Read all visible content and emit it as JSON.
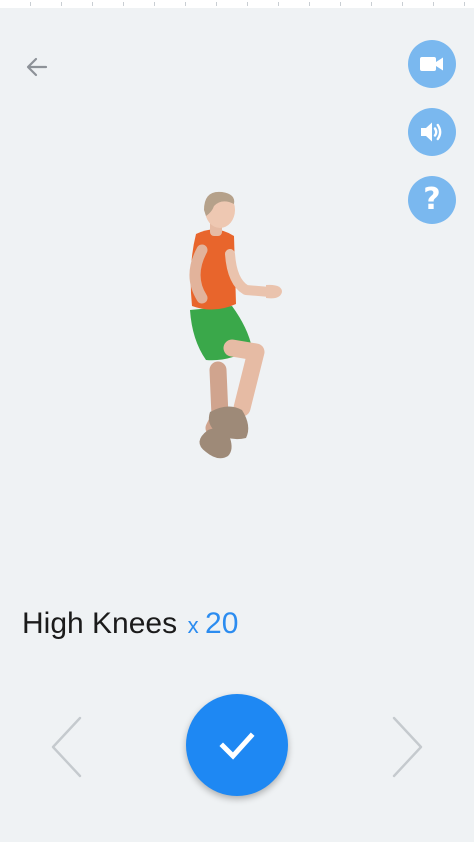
{
  "colors": {
    "background": "#eff2f4",
    "accent": "#1e88f3",
    "action_button_bg": "#7ab8ef",
    "rep_text": "#2b8cf0",
    "nav_arrow": "#c5cace"
  },
  "header": {
    "back_icon": "arrow-left-icon",
    "actions": [
      {
        "name": "video",
        "icon": "video-camera-icon"
      },
      {
        "name": "sound",
        "icon": "speaker-volume-icon"
      },
      {
        "name": "help",
        "icon": "question-mark-icon",
        "glyph": "?"
      }
    ]
  },
  "exercise": {
    "name": "High Knees",
    "multiplier": "x",
    "reps": "20",
    "illustration": "high-knees-exercise-figure"
  },
  "controls": {
    "prev_icon": "chevron-left-icon",
    "done_icon": "checkmark-icon",
    "next_icon": "chevron-right-icon"
  }
}
